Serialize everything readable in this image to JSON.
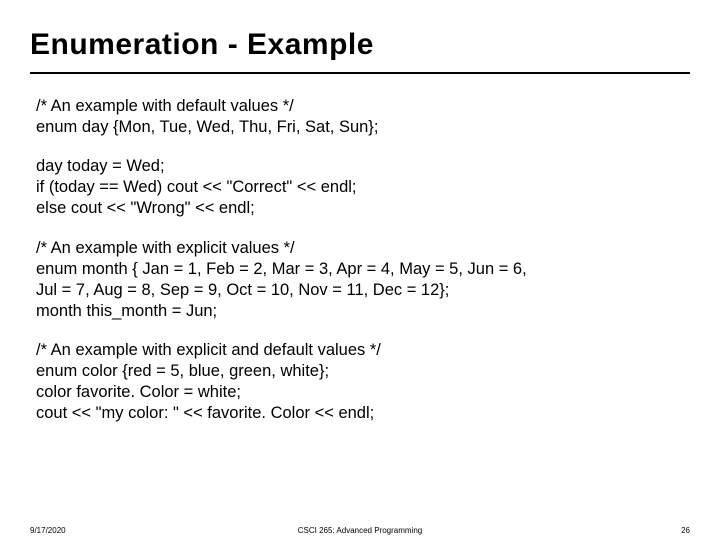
{
  "title": "Enumeration - Example",
  "blocks": {
    "b1": {
      "l1": "/* An example with default values */",
      "l2": "enum day {Mon, Tue, Wed, Thu, Fri, Sat, Sun};"
    },
    "b2": {
      "l1": "day today = Wed;",
      "l2": "if (today == Wed) cout << \"Correct\" << endl;",
      "l3": "else cout << \"Wrong\" << endl;"
    },
    "b3": {
      "l1": "/* An example with explicit values */",
      "l2": "enum month { Jan = 1, Feb = 2, Mar = 3, Apr = 4, May = 5, Jun = 6,",
      "l3": "Jul = 7, Aug = 8, Sep = 9, Oct = 10, Nov = 11, Dec = 12};",
      "l4": "month this_month = Jun;"
    },
    "b4": {
      "l1": "/* An example with explicit and default values */",
      "l2": "enum color {red = 5, blue, green, white};",
      "l3": "color favorite. Color = white;",
      "l4": "cout << \"my color: \" << favorite. Color << endl;"
    }
  },
  "footer": {
    "date": "9/17/2020",
    "course": "CSCI 265: Advanced Programming",
    "page": "26"
  }
}
